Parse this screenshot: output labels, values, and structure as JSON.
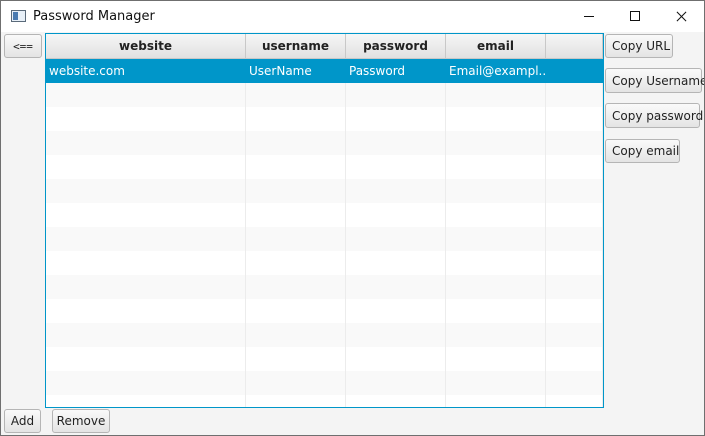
{
  "window": {
    "title": "Password Manager"
  },
  "toolbar": {
    "back_label": "<=="
  },
  "table": {
    "columns": [
      "website",
      "username",
      "password",
      "email",
      ""
    ],
    "rows": [
      {
        "website": "website.com",
        "username": "UserName",
        "password": "Password",
        "email": "Email@exampl...",
        "extra": ""
      }
    ]
  },
  "side_buttons": {
    "copy_url": "Copy URL",
    "copy_username": "Copy Username",
    "copy_password": "Copy password",
    "copy_email": "Copy email"
  },
  "bottom_buttons": {
    "add": "Add",
    "remove": "Remove"
  },
  "colors": {
    "accent": "#0096c9",
    "window_bg": "#f4f4f4"
  }
}
